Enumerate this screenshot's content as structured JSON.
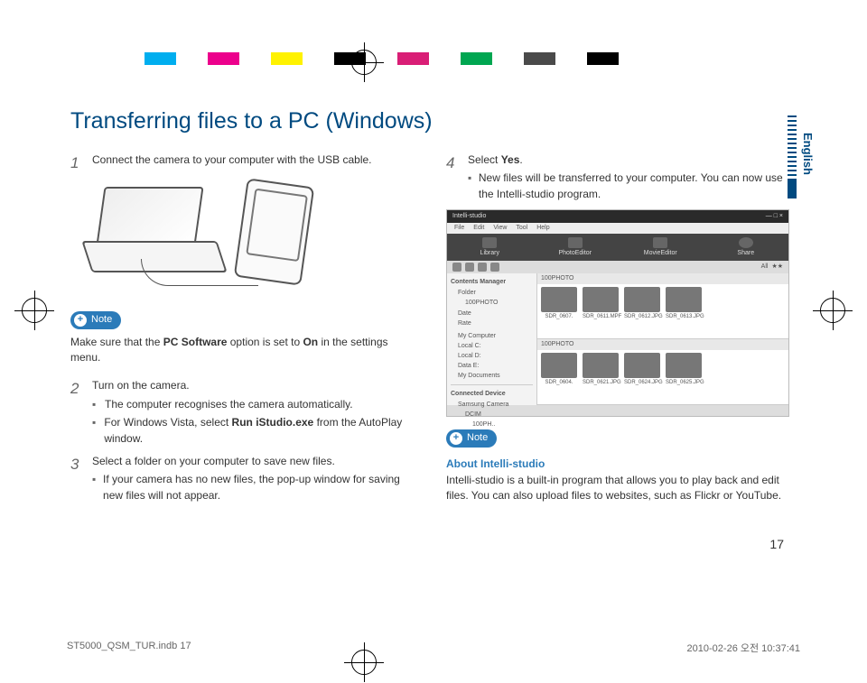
{
  "language_tab": "English",
  "heading": "Transferring files to a PC (Windows)",
  "steps": {
    "s1": {
      "num": "1",
      "text": "Connect the camera to your computer with the USB cable."
    },
    "s2": {
      "num": "2",
      "text": "Turn on the camera.",
      "bullets": [
        "The computer recognises the camera automatically.",
        "For Windows Vista, select Run iStudio.exe from the AutoPlay window."
      ],
      "run_label": "Run iStudio.exe"
    },
    "s3": {
      "num": "3",
      "text": "Select a folder on your computer to save new files.",
      "bullets": [
        "If your camera has no new files, the pop-up window for saving new files will not appear."
      ]
    },
    "s4": {
      "num": "4",
      "text": "Select Yes.",
      "yes_label": "Yes",
      "bullets": [
        "New files will be transferred to your computer. You can now use the Intelli-studio program."
      ]
    }
  },
  "note1": {
    "badge": "Note",
    "text": "Make sure that the PC Software option is set to On in the settings menu.",
    "pc_software_label": "PC Software",
    "on_label": "On"
  },
  "note2": {
    "badge": "Note",
    "title": "About Intelli-studio",
    "text": "Intelli-studio is a built-in program that allows you to play back and edit files. You can also upload files to websites, such as Flickr or YouTube."
  },
  "app_shot": {
    "title": "Intelli-studio",
    "menus": [
      "File",
      "Edit",
      "View",
      "Tool",
      "Help"
    ],
    "nav": [
      "Library",
      "PhotoEditor",
      "MovieEditor",
      "Share"
    ],
    "toolbar_right": [
      "All",
      "★★"
    ],
    "sidebar": {
      "section1_head": "Contents Manager",
      "section1_items": [
        "Folder",
        "100PHOTO",
        "Date",
        "Rate"
      ],
      "section2_items": [
        "My Computer",
        "Local C:",
        "Local D:",
        "Data E:",
        "My Documents"
      ],
      "section3_head": "Connected Device",
      "section3_items": [
        "Samsung Camera",
        "DCIM",
        "100PH.."
      ]
    },
    "panel1": {
      "head": "100PHOTO",
      "thumbs": [
        "SDR_0607.",
        "SDR_0611.MPF",
        "SDR_0612.JPG",
        "SDR_0613.JPG"
      ]
    },
    "panel2": {
      "head": "100PHOTO",
      "thumbs": [
        "SDR_0604.",
        "SDR_0621.JPG",
        "SDR_0624.JPG",
        "SDR_0625.JPG"
      ]
    }
  },
  "page_number": "17",
  "footer": {
    "left": "ST5000_QSM_TUR.indb   17",
    "right": "2010-02-26   오전 10:37:41"
  }
}
